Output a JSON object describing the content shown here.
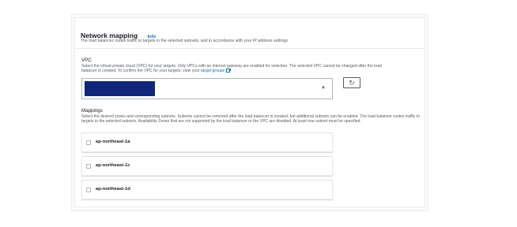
{
  "section": {
    "title": "Network mapping",
    "info_label": "Info",
    "description": "The load balancer routes traffic to targets in the selected subnets, and in accordance with your IP address settings."
  },
  "vpc": {
    "label": "VPC",
    "help_line1": "Select the virtual private cloud (VPC) for your targets. Only VPCs with an internet gateway are enabled for selection. The selected VPC cannot be changed after the load",
    "help_line2_prefix": "balancer is created. To confirm the VPC for your targets, view your",
    "help_link": "target groups",
    "select_value": "",
    "caret_icon": "caret-down-icon",
    "refresh_icon": "refresh-icon"
  },
  "mappings": {
    "label": "Mappings",
    "help": "Select the desired zones and corresponding subnets. Subnets cannot be removed after the load balancer is created, but additional subnets can be enabled. The load balancer routes traffic to targets in the selected subnets. Availability Zones that are not supported by the load balancer or the VPC are disabled. At least one subnet must be specified.",
    "zones": [
      {
        "name": "ap-northeast-1a",
        "checked": false
      },
      {
        "name": "ap-northeast-1c",
        "checked": false
      },
      {
        "name": "ap-northeast-1d",
        "checked": false
      }
    ]
  },
  "colors": {
    "link": "#0073bb",
    "redacted": "#10267a",
    "border": "#aab7b8",
    "text": "#16191f",
    "muted": "#545b64"
  }
}
